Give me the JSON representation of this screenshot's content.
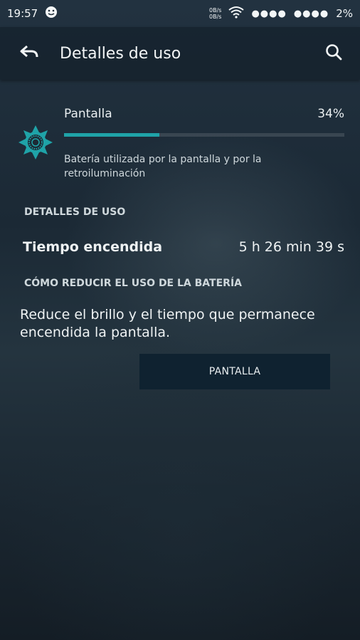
{
  "status_bar": {
    "time": "19:57",
    "speed_up": "0B/s",
    "speed_down": "0B/s",
    "signal_1": "●●●●",
    "signal_2": "●●●●",
    "battery_percent": "2%"
  },
  "app_bar": {
    "title": "Detalles de uso",
    "back_icon": "back-arrow-icon",
    "search_icon": "search-icon"
  },
  "usage_item": {
    "name": "Pantalla",
    "percent_label": "34%",
    "percent_value": 34,
    "icon": "screen-brightness-icon",
    "description": "Batería utilizada por la pantalla y por la retroiluminación"
  },
  "details_section": {
    "header": "DETALLES DE USO",
    "rows": [
      {
        "label": "Tiempo encendida",
        "value": "5 h 26 min 39 s"
      }
    ]
  },
  "reduce_section": {
    "header": "CÓMO REDUCIR EL USO DE LA BATERÍA",
    "tip": "Reduce el brillo y el tiempo que permanece encendida la pantalla.",
    "button_label": "PANTALLA"
  },
  "colors": {
    "accent": "#1fa3a8",
    "button_bg": "#0f2230"
  }
}
